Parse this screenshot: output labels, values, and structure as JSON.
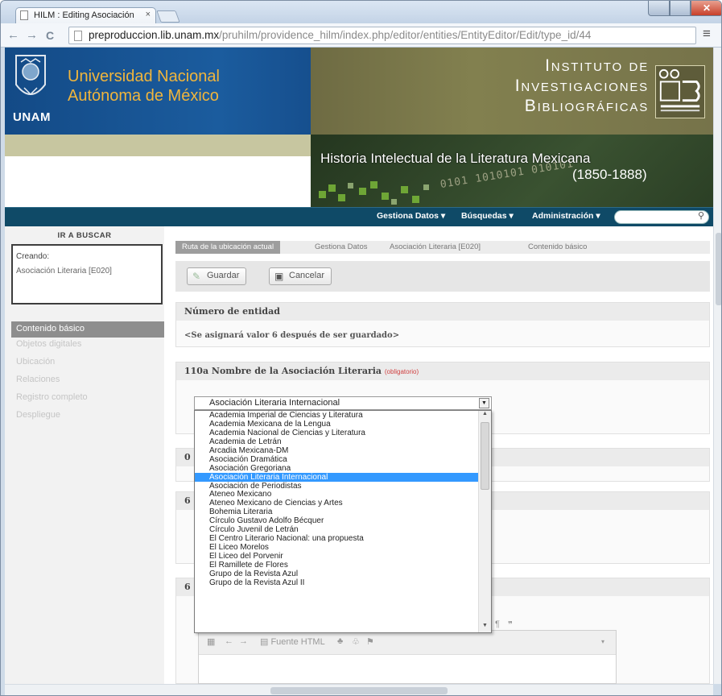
{
  "browser": {
    "tab_title": "HILM : Editing Asociación",
    "tab_close": "×",
    "url_host": "preproduccion.lib.unam.mx",
    "url_path": "/pruhilm/providence_hilm/index.php/editor/entities/EntityEditor/Edit/type_id/44",
    "back": "←",
    "forward": "→",
    "reload": "C"
  },
  "header": {
    "unam": "UNAM",
    "university_line1": "Universidad Nacional",
    "university_line2": "Autónoma de México",
    "institute_line1": "Instituto de",
    "institute_line2": "Investigaciones",
    "institute_line3": "Bibliográficas",
    "project_title": "Historia Intelectual de la Literatura Mexicana",
    "project_years": "(1850-1888)",
    "binary_deco": "0101 1010101 010101"
  },
  "navbar": {
    "items": [
      "Gestiona Datos ▾",
      "Búsquedas ▾",
      "Administración ▾"
    ],
    "search_placeholder": ""
  },
  "sidebar": {
    "ir_buscar": "IR A BUSCAR",
    "creando_label": "Creando:",
    "creando_value": "Asociación Literaria [E020]",
    "items": [
      "Contenido básico",
      "Objetos digitales",
      "Ubicación",
      "Relaciones",
      "Registro completo",
      "Despliegue"
    ]
  },
  "breadcrumb": [
    "Ruta de la ubicación actual",
    "Gestiona Datos",
    "Asociación Literaria [E020]",
    "Contenido básico"
  ],
  "actions": {
    "save": "Guardar",
    "cancel": "Cancelar"
  },
  "sections": {
    "entity_number_label": "Número de entidad",
    "entity_number_note": "<Se asignará valor 6 después de ser guardado>",
    "name_label": "110a Nombre de la Asociación Literaria",
    "required": "(obligatorio)",
    "partial_letters": [
      "0",
      "6",
      "6"
    ]
  },
  "select": {
    "value": "Asociación Literaria Internacional",
    "options": [
      "Academia Imperial de Ciencias y Literatura",
      "Academia Mexicana de la Lengua",
      "Academia Nacional de Ciencias y Literatura",
      "Academia de Letrán",
      "Arcadia Mexicana-DM",
      "Asociación Dramática",
      "Asociación Gregoriana",
      "Asociación Literaria Internacional",
      "Asociación de Periodistas",
      "Ateneo Mexicano",
      "Ateneo Mexicano de Ciencias y Artes",
      "Bohemia Literaria",
      "Círculo Gustavo Adolfo Bécquer",
      "Círculo Juvenil de Letrán",
      "El Centro Literario Nacional: una propuesta",
      "El Liceo Morelos",
      "El Liceo del Porvenir",
      "El Ramillete de Flores",
      "Grupo de la Revista Azul",
      "Grupo de la Revista Azul II"
    ],
    "selected_index": 7
  },
  "editor": {
    "source_html": "Fuente HTML"
  },
  "colors": {
    "unam_blue": "#1b5c9e",
    "gold": "#f0b53c",
    "olive": "#82804f",
    "nav": "#0f4a67",
    "highlight": "#3399ff"
  }
}
